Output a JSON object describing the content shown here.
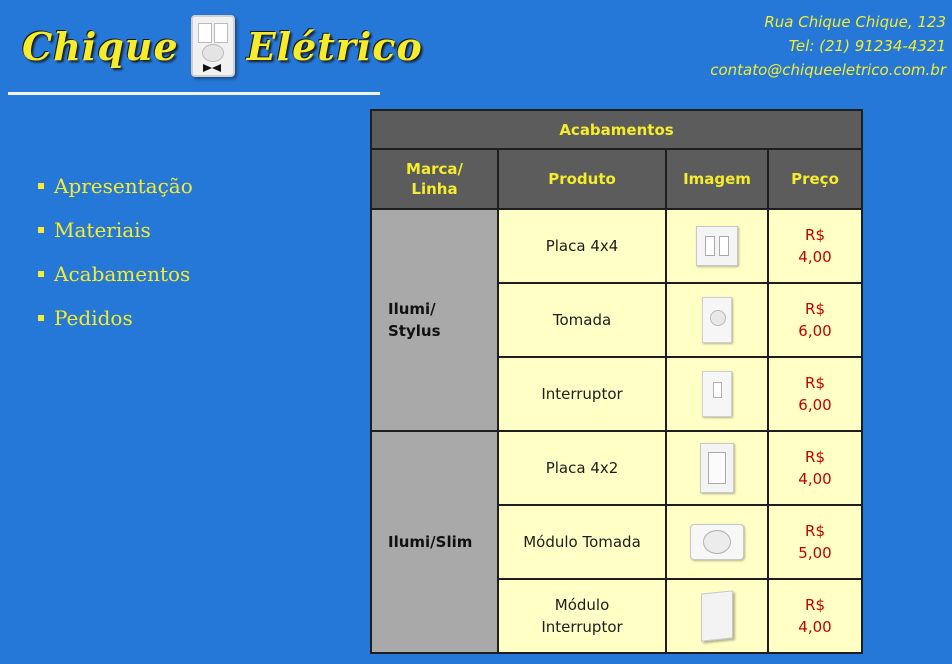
{
  "header": {
    "logo_left": "Chique",
    "logo_right": "Elétrico",
    "address": "Rua Chique Chique, 123",
    "phone": "Tel: (21) 91234-4321",
    "email": "contato@chiqueeletrico.com.br"
  },
  "nav": {
    "items": [
      {
        "label": "Apresentação"
      },
      {
        "label": "Materiais"
      },
      {
        "label": "Acabamentos"
      },
      {
        "label": "Pedidos"
      }
    ]
  },
  "table": {
    "caption": "Acabamentos",
    "headers": {
      "brand": "Marca/ Linha",
      "product": "Produto",
      "image": "Imagem",
      "price": "Preço"
    },
    "groups": [
      {
        "brand": "Ilumi/ Stylus",
        "rows": [
          {
            "product": "Placa 4x4",
            "image": "placa-4x4-icon",
            "price": "R$ 4,00"
          },
          {
            "product": "Tomada",
            "image": "tomada-icon",
            "price": "R$ 6,00"
          },
          {
            "product": "Interruptor",
            "image": "interruptor-icon",
            "price": "R$ 6,00"
          }
        ]
      },
      {
        "brand": "Ilumi/Slim",
        "rows": [
          {
            "product": "Placa 4x2",
            "image": "placa-4x2-icon",
            "price": "R$ 4,00"
          },
          {
            "product": "Módulo Tomada",
            "image": "modulo-tomada-icon",
            "price": "R$ 5,00"
          },
          {
            "product": "Módulo Interruptor",
            "image": "modulo-interruptor-icon",
            "price": "R$ 4,00"
          }
        ]
      }
    ]
  },
  "colors": {
    "background": "#2678d8",
    "accent": "#f4ec2c",
    "table_header": "#5c5c5c",
    "brand_cell": "#a9a9a9",
    "row_bg": "#ffffc6",
    "price_text": "#c40000"
  }
}
